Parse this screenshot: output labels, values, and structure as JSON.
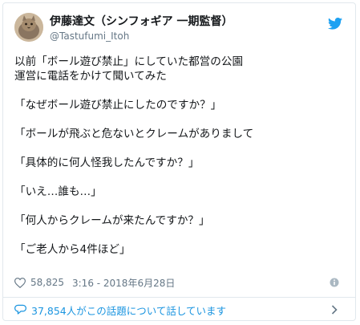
{
  "author": {
    "display_name": "伊藤達文（シンフォギア 一期監督）",
    "handle": "@Tastufumi_Itoh"
  },
  "tweet_lines": [
    "以前「ボール遊び禁止」にしていた都営の公園",
    "運営に電話をかけて聞いてみた",
    "",
    "「なぜボール遊び禁止にしたのですか？」",
    "",
    "「ボールが飛ぶと危ないとクレームがありまして",
    "",
    "「具体的に何人怪我したんですか？」",
    "",
    "「いえ…誰も…」",
    "",
    "「何人からクレームが来たんですか？」",
    "",
    "「ご老人から4件ほど」"
  ],
  "meta": {
    "likes": "58,825",
    "timestamp": "3:16 - 2018年6月28日"
  },
  "footer": {
    "conversation_text": "37,854人がこの話題について話しています"
  },
  "colors": {
    "accent": "#1b95e0",
    "twitter_bird": "#1da1f2",
    "secondary_text": "#657786",
    "border": "#e1e8ed"
  },
  "icons": {
    "brand": "twitter-bird-icon",
    "like": "heart-icon",
    "info": "info-icon",
    "reply": "speech-bubble-icon",
    "next": "chevron-right-icon"
  }
}
